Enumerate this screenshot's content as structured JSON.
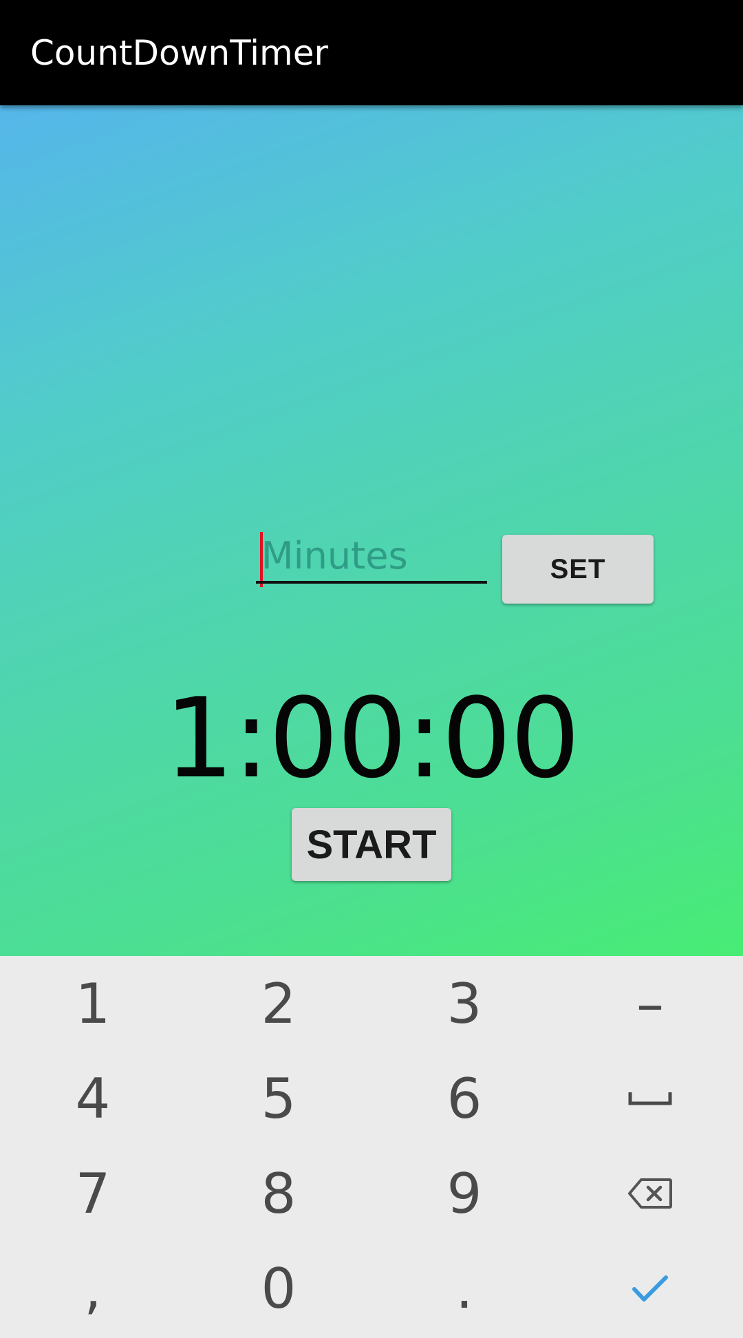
{
  "appbar": {
    "title": "CountDownTimer"
  },
  "input": {
    "value": "",
    "placeholder": "Minutes"
  },
  "set_button": {
    "label": "SET"
  },
  "timer": {
    "display": "1:00:00"
  },
  "start_button": {
    "label": "START"
  },
  "keyboard": {
    "rows": [
      [
        "1",
        "2",
        "3",
        "–"
      ],
      [
        "4",
        "5",
        "6",
        "space-icon"
      ],
      [
        "7",
        "8",
        "9",
        "backspace-icon"
      ],
      [
        ",",
        "0",
        ".",
        "done-check-icon"
      ]
    ]
  },
  "colors": {
    "appbar": "#000000",
    "gradient_start": "#55b6ea",
    "gradient_end": "#48ec74",
    "button_bg": "#d8d9d9",
    "caret": "#e01020",
    "keyboard_bg": "#ebebeb",
    "check_icon": "#3b9be0"
  }
}
